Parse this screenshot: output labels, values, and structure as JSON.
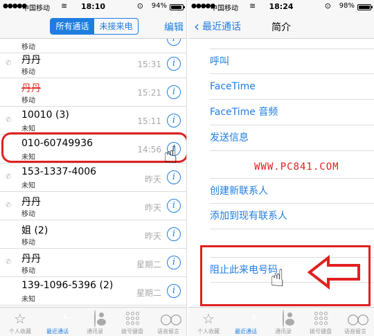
{
  "left": {
    "status": {
      "carrier": "中国移动",
      "time": "18:10",
      "battery": "94%",
      "battery_level": 0.94
    },
    "nav": {
      "tab_all": "所有通话",
      "tab_missed": "未接来电",
      "edit": "编辑"
    },
    "calls": [
      {
        "name": "",
        "sub": "移动",
        "time": "",
        "missed": false
      },
      {
        "name": "丹丹",
        "sub": "移动",
        "time": "15:31",
        "missed": false
      },
      {
        "name": "丹丹",
        "sub": "移动",
        "time": "15:21",
        "missed": true
      },
      {
        "name": "10010 (3)",
        "sub": "未知",
        "time": "15:11",
        "missed": false
      },
      {
        "name": "010-60749936",
        "sub": "未知",
        "time": "14:56",
        "missed": false
      },
      {
        "name": "153-1337-4006",
        "sub": "未知",
        "time": "昨天",
        "missed": false
      },
      {
        "name": "丹丹",
        "sub": "移动",
        "time": "昨天",
        "missed": false
      },
      {
        "name": "姐 (2)",
        "sub": "移动",
        "time": "昨天",
        "missed": false
      },
      {
        "name": "丹丹",
        "sub": "移动",
        "time": "星期二",
        "missed": false
      },
      {
        "name": "139-1096-5396 (2)",
        "sub": "未知",
        "time": "星期二",
        "missed": false
      }
    ],
    "tabs": [
      "个人收藏",
      "最近通话",
      "通讯录",
      "拨号键盘",
      "语音留言"
    ]
  },
  "right": {
    "status": {
      "carrier": "中国移动",
      "time": "18:24",
      "battery": "98%",
      "battery_level": 0.98
    },
    "nav": {
      "back": "最近通话",
      "title": "简介"
    },
    "menu": {
      "call": "呼叫",
      "facetime": "FaceTime",
      "facetime_audio": "FaceTime 音频",
      "send_message": "发送信息",
      "create_contact": "创建新联系人",
      "add_existing": "添加到现有联系人",
      "block": "阻止此来电号码"
    },
    "watermark": "WWW.PC841.COM",
    "tabs": [
      "个人收藏",
      "最近通话",
      "通讯录",
      "拨号键盘",
      "语音留言"
    ]
  },
  "colors": {
    "accent": "#1f7de0",
    "highlight": "#e02020",
    "missed": "#e0332b"
  }
}
